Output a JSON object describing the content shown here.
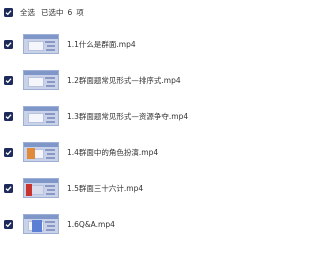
{
  "header": {
    "select_all_label": "全选",
    "selected_prefix": "已选中",
    "selected_count": "6",
    "selected_unit": "项"
  },
  "files": [
    {
      "name": "1.1什么是群面.mp4",
      "thumb": "plain"
    },
    {
      "name": "1.2群面题常见形式—排序式.mp4",
      "thumb": "plain"
    },
    {
      "name": "1.3群面题常见形式—资源争夺.mp4",
      "thumb": "plain"
    },
    {
      "name": "1.4群面中的角色扮演.mp4",
      "thumb": "plain"
    },
    {
      "name": "1.5群面三十六计.mp4",
      "thumb": "red"
    },
    {
      "name": "1.6Q&A.mp4",
      "thumb": "blue"
    }
  ],
  "colors": {
    "checkbox": "#1f2a5c"
  }
}
